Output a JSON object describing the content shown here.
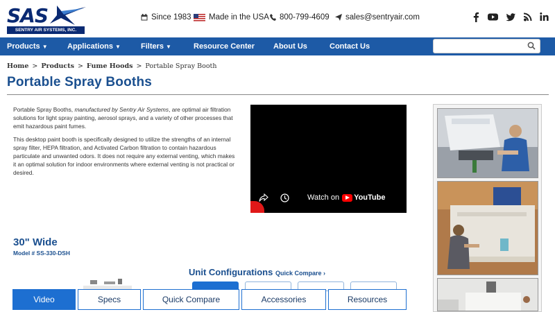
{
  "header": {
    "logo_text": "SAS",
    "logo_tagline": "SENTRY AIR SYSTEMS, INC.",
    "since": "Since 1983",
    "made_in": "Made in the USA",
    "phone": "800-799-4609",
    "email": "sales@sentryair.com",
    "social": [
      "facebook-icon",
      "youtube-icon",
      "twitter-icon",
      "blog-icon",
      "linkedin-icon"
    ]
  },
  "nav": {
    "items": [
      {
        "label": "Products",
        "dropdown": true
      },
      {
        "label": "Applications",
        "dropdown": true
      },
      {
        "label": "Filters",
        "dropdown": true
      },
      {
        "label": "Resource Center",
        "dropdown": false
      },
      {
        "label": "About Us",
        "dropdown": false
      },
      {
        "label": "Contact Us",
        "dropdown": false
      }
    ],
    "search_placeholder": ""
  },
  "breadcrumb": {
    "items": [
      "Home",
      "Products",
      "Fume Hoods",
      "Portable Spray Booth"
    ],
    "separator": ">"
  },
  "page_title": "Portable Spray Booths",
  "intro": {
    "p1_lead": "Portable Spray Booths, ",
    "p1_italic": "manufactured by Sentry Air Systems",
    "p1_rest": ", are optimal air filtration solutions for light spray painting, aerosol sprays, and a variety of other processes that emit hazardous paint fumes.",
    "p2": "This desktop paint booth is specifically designed to utilize the strengths of an internal spray filter, HEPA filtration, and Activated Carbon filtration to contain hazardous particulate and unwanted odors. It does not require any external venting, which makes it an optimal solution for indoor environments where external venting is not practical or desired."
  },
  "video": {
    "watch_on": "Watch on",
    "youtube": "YouTube"
  },
  "product": {
    "title": "30\" Wide",
    "model": "Model # SS-330-DSH",
    "unit_configurations": "Unit Configurations",
    "quick_compare": "Quick Compare ›"
  },
  "tabs": [
    {
      "label": "Video",
      "active": true
    },
    {
      "label": "Specs",
      "active": false
    },
    {
      "label": "Quick Compare",
      "active": false
    },
    {
      "label": "Accessories",
      "active": false
    },
    {
      "label": "Resources",
      "active": false
    }
  ],
  "colors": {
    "nav_bg": "#1d5aa6",
    "title_blue": "#1a4f8f",
    "accent_blue": "#1d6fd1"
  }
}
